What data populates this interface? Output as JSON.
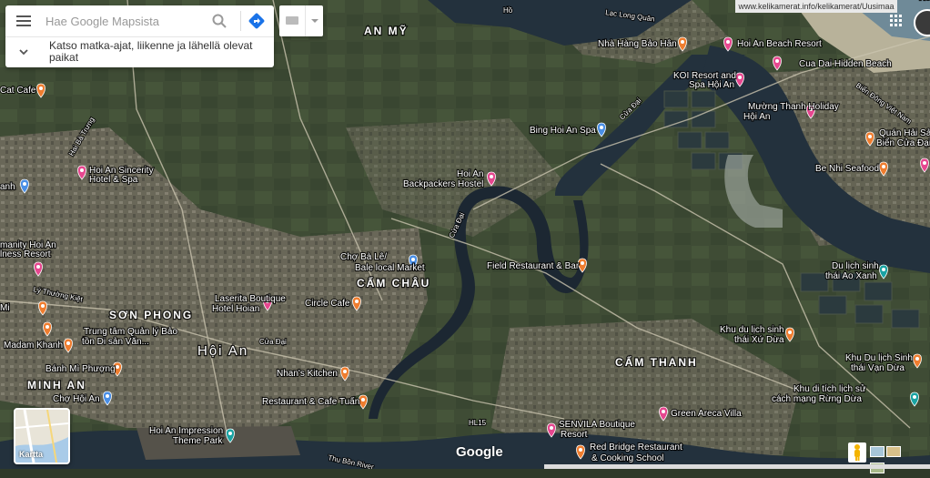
{
  "search": {
    "placeholder": "Hae Google Mapsista",
    "expand_text": "Katso matka-ajat, liikenne ja lähellä olevat paikat"
  },
  "url_banner": "www.kelikamerat.info/kelikamerat/Uusimaa",
  "layer_toggle": {
    "label": "Kartta"
  },
  "brand": "Google",
  "colors": {
    "poi_pink": "#e6478f",
    "poi_orange": "#ef7d2f",
    "poi_blue": "#4a8fe6",
    "poi_teal": "#1aa3a3",
    "water": "#23313d",
    "land": "#3d4a33"
  },
  "areas": [
    "AN MỸ",
    "SƠN PHONG",
    "CẨM CHÂU",
    "CẨM THANH",
    "MINH AN",
    "Hội An"
  ],
  "roads": [
    "Lạc Long Quân",
    "Cửa Đại",
    "Hai Bà Trưng",
    "Lý Thường Kiệt",
    "Biển Đông Việt Nam",
    "HL15",
    "Thu Bồn River",
    "Hồ"
  ],
  "pois": [
    {
      "label": "Nhà Hàng Bảo Hân",
      "kind": "food"
    },
    {
      "label": "Hoi An Beach Resort",
      "kind": "hotel"
    },
    {
      "label": "Cua Dai Hidden Beach",
      "kind": "hotel"
    },
    {
      "label": "KOI Resort and Spa Hội An",
      "kind": "hotel"
    },
    {
      "label": "Mường Thanh Holiday Hội An",
      "kind": "hotel"
    },
    {
      "label": "Bing Hoi An Spa",
      "kind": "spa"
    },
    {
      "label": "Quán Hải Sản Biển Cửa Đại",
      "kind": "food"
    },
    {
      "label": "Be Nhi Seafood",
      "kind": "food"
    },
    {
      "label": "Hoi An Backpackers Hostel",
      "kind": "hotel"
    },
    {
      "label": "Hoi An Sincerity Hotel & Spa",
      "kind": "hotel"
    },
    {
      "label": "Cat Cafe",
      "kind": "food"
    },
    {
      "label": "manity Hoi An lness Resort",
      "kind": "hotel"
    },
    {
      "label": "Chợ Bà Lê/ Bale local Market",
      "kind": "shop"
    },
    {
      "label": "Field Restaurant & Bar",
      "kind": "food"
    },
    {
      "label": "Du lịch sinh thái Ao Xanh",
      "kind": "park"
    },
    {
      "label": "Laserita Boutique Hotel Hoian",
      "kind": "hotel"
    },
    {
      "label": "Circle Cafe",
      "kind": "food"
    },
    {
      "label": "Trung tâm Quản lý Bảo tồn Di sản Văn...",
      "kind": "food"
    },
    {
      "label": "Madam Khanh",
      "kind": "food"
    },
    {
      "label": "Bánh Mì Phượng",
      "kind": "food"
    },
    {
      "label": "Chợ Hội An",
      "kind": "shop"
    },
    {
      "label": "Nhan's Kitchen",
      "kind": "food"
    },
    {
      "label": "Restaurant & Cafe Tuấn",
      "kind": "food"
    },
    {
      "label": "Khu du lịch sinh thái Xứ Dừa",
      "kind": "food"
    },
    {
      "label": "Khu Du lịch Sinh thái Vạn Dừa",
      "kind": "food"
    },
    {
      "label": "Khu di tích lịch sử cách mạng Rừng Dừa",
      "kind": "park"
    },
    {
      "label": "Green Areca Villa",
      "kind": "hotel"
    },
    {
      "label": "SENVILA Boutique Resort",
      "kind": "hotel"
    },
    {
      "label": "Red Bridge Restaurant & Cooking School",
      "kind": "food"
    },
    {
      "label": "Hoi An Impression Theme Park",
      "kind": "park"
    },
    {
      "label": "Mi",
      "kind": "food"
    },
    {
      "label": "anh",
      "kind": "spa"
    },
    {
      "label": "Hồ",
      "kind": "hotel"
    }
  ]
}
